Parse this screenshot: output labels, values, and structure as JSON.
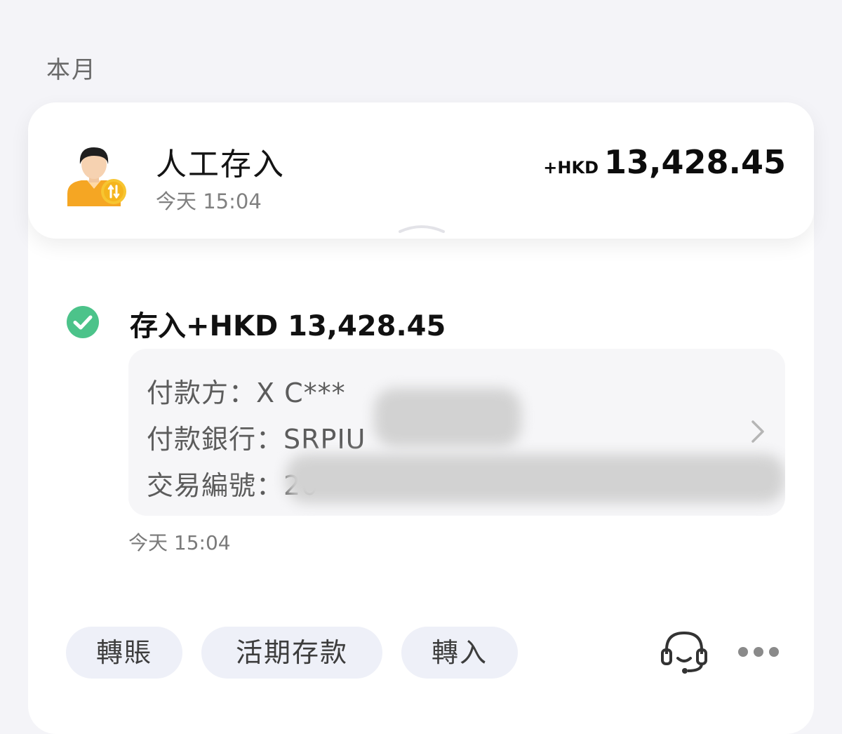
{
  "section": {
    "label": "本月"
  },
  "summary": {
    "title": "人工存入",
    "time": "今天 15:04",
    "currency": "+HKD",
    "amount": "13,428.45",
    "avatar_icon": "agent-person-coin-icon"
  },
  "detail": {
    "status_icon": "check-circle-icon",
    "status_color": "#4cc38a",
    "status_text": "存入+HKD 13,428.45",
    "lines": [
      "付款方：X C***",
      "付款銀行：SRPIU",
      "交易編號：20"
    ],
    "time": "今天 15:04"
  },
  "actions": {
    "chips": [
      "轉賬",
      "活期存款",
      "轉入"
    ],
    "support_icon": "headset-icon",
    "more_icon": "more-dots-icon"
  },
  "colors": {
    "background": "#f4f4f8",
    "chip_background": "#eef0f8",
    "avatar_accent": "#f5a623"
  }
}
